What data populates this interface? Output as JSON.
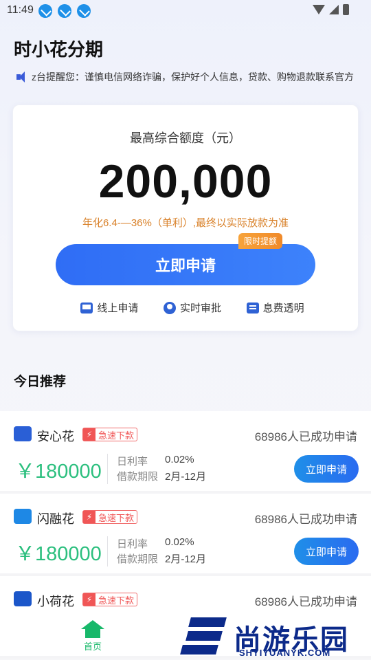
{
  "status_bar": {
    "time": "11:49"
  },
  "app": {
    "title": "时小花分期"
  },
  "notice": {
    "text": "z台提醒您：谨慎电信网络诈骗，保护好个人信息，贷款、购物退款联系官方"
  },
  "card": {
    "quota_label": "最高综合额度（元）",
    "quota_value": "200,000",
    "rate_note": "年化6.4-—36%（单利）,最终以实际放款为准",
    "apply_label": "立即申请",
    "limit_tag": "限时提额",
    "features": [
      "线上申请",
      "实时审批",
      "息费透明"
    ]
  },
  "section": {
    "title": "今日推荐"
  },
  "products": [
    {
      "name": "安心花",
      "badge": "急速下款",
      "applied": "68986人已成功申请",
      "amount": "￥180000",
      "rate_label": "日利率",
      "rate_value": "0.02%",
      "term_label": "借款期限",
      "term_value": "2月-12月",
      "apply_label": "立即申请",
      "logo_color": "#2a5fd6"
    },
    {
      "name": "闪融花",
      "badge": "急速下款",
      "applied": "68986人已成功申请",
      "amount": "￥180000",
      "rate_label": "日利率",
      "rate_value": "0.02%",
      "term_label": "借款期限",
      "term_value": "2月-12月",
      "apply_label": "立即申请",
      "logo_color": "#1e88e5"
    },
    {
      "name": "小荷花",
      "badge": "急速下款",
      "applied": "68986人已成功申请",
      "amount": "",
      "rate_label": "",
      "rate_value": "",
      "term_label": "",
      "term_value": "",
      "apply_label": "",
      "logo_color": "#1b56c9"
    }
  ],
  "tabbar": {
    "home_label": "首页"
  },
  "watermark": {
    "cn": "尚游乐园",
    "en": "SHYIYUANYK.COM"
  },
  "colors": {
    "primary": "#2f6df5",
    "green": "#2bbf7e",
    "orange": "#d9822b",
    "red": "#f05656"
  }
}
